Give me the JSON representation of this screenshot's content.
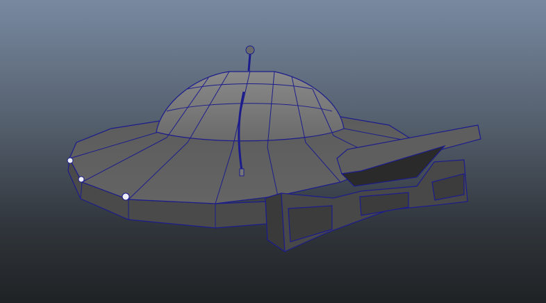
{
  "viewport": {
    "model": "ufo-saucer",
    "display_mode": "wireframe-on-shaded",
    "colors": {
      "background_top": "#7889a0",
      "background_bottom": "#1f2225",
      "mesh": "#5a5a5a",
      "wireframe": "#1c1c8c"
    }
  }
}
